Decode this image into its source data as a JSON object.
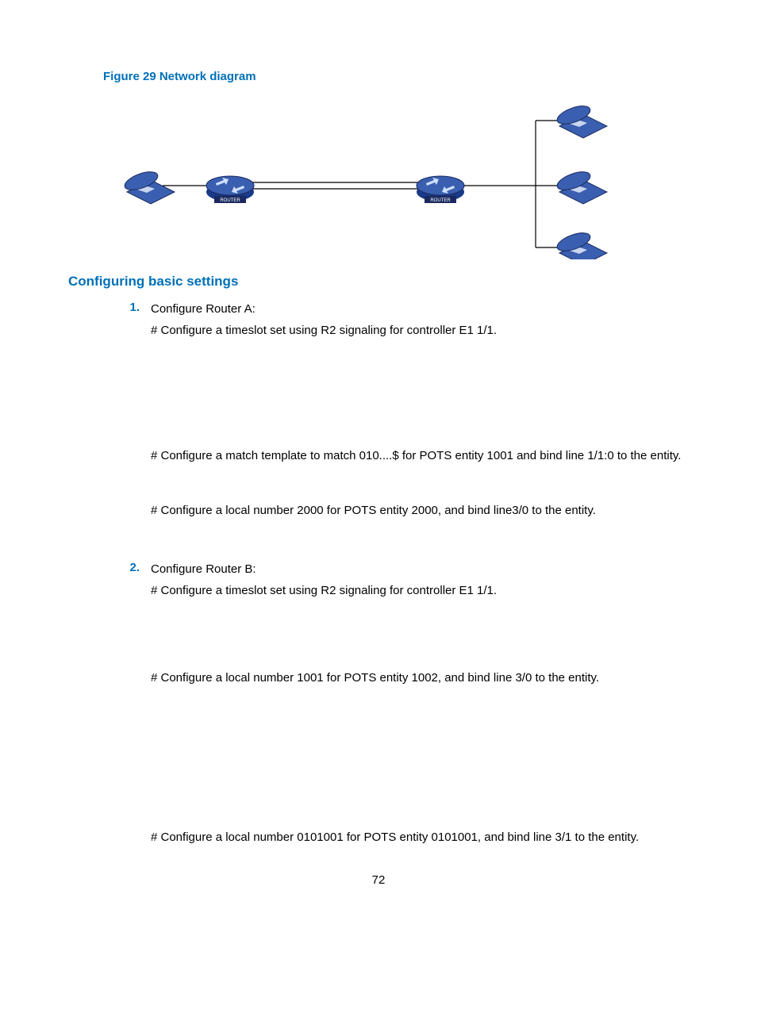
{
  "figure_title": "Figure 29 Network diagram",
  "section_heading": "Configuring basic settings",
  "steps": [
    {
      "num": "1.",
      "lines": [
        "Configure Router A:",
        "# Configure a timeslot set using R2 signaling for controller E1 1/1.",
        "",
        "# Configure a match template to match 010....$ for POTS entity 1001 and bind line 1/1:0 to the entity.",
        "",
        "# Configure a local number 2000 for POTS entity 2000, and bind line3/0 to the entity."
      ]
    },
    {
      "num": "2.",
      "lines": [
        "Configure Router B:",
        "# Configure a timeslot set using R2 signaling for controller E1 1/1.",
        "",
        "# Configure a local number 1001 for POTS entity 1002, and bind line 3/0 to the entity.",
        "",
        "# Configure a local number 0101001 for POTS entity 0101001, and bind line 3/1 to the entity."
      ]
    }
  ],
  "router_label": "ROUTER",
  "page_number": "72"
}
